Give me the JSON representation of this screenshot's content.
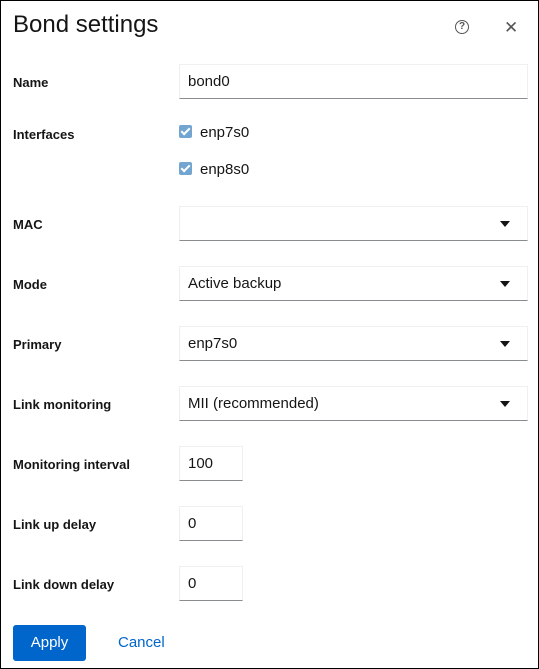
{
  "dialog": {
    "title": "Bond settings",
    "help_icon": "?",
    "close_icon": "✕"
  },
  "form": {
    "name": {
      "label": "Name",
      "value": "bond0"
    },
    "interfaces": {
      "label": "Interfaces",
      "items": [
        {
          "name": "enp7s0",
          "checked": true
        },
        {
          "name": "enp8s0",
          "checked": true
        }
      ]
    },
    "mac": {
      "label": "MAC",
      "value": ""
    },
    "mode": {
      "label": "Mode",
      "value": "Active backup"
    },
    "primary": {
      "label": "Primary",
      "value": "enp7s0"
    },
    "link_monitoring": {
      "label": "Link monitoring",
      "value": "MII (recommended)"
    },
    "monitoring_interval": {
      "label": "Monitoring interval",
      "value": "100"
    },
    "link_up_delay": {
      "label": "Link up delay",
      "value": "0"
    },
    "link_down_delay": {
      "label": "Link down delay",
      "value": "0"
    }
  },
  "footer": {
    "apply_label": "Apply",
    "cancel_label": "Cancel"
  },
  "colors": {
    "primary": "#0066cc",
    "checkbox": "#73a5d1"
  }
}
